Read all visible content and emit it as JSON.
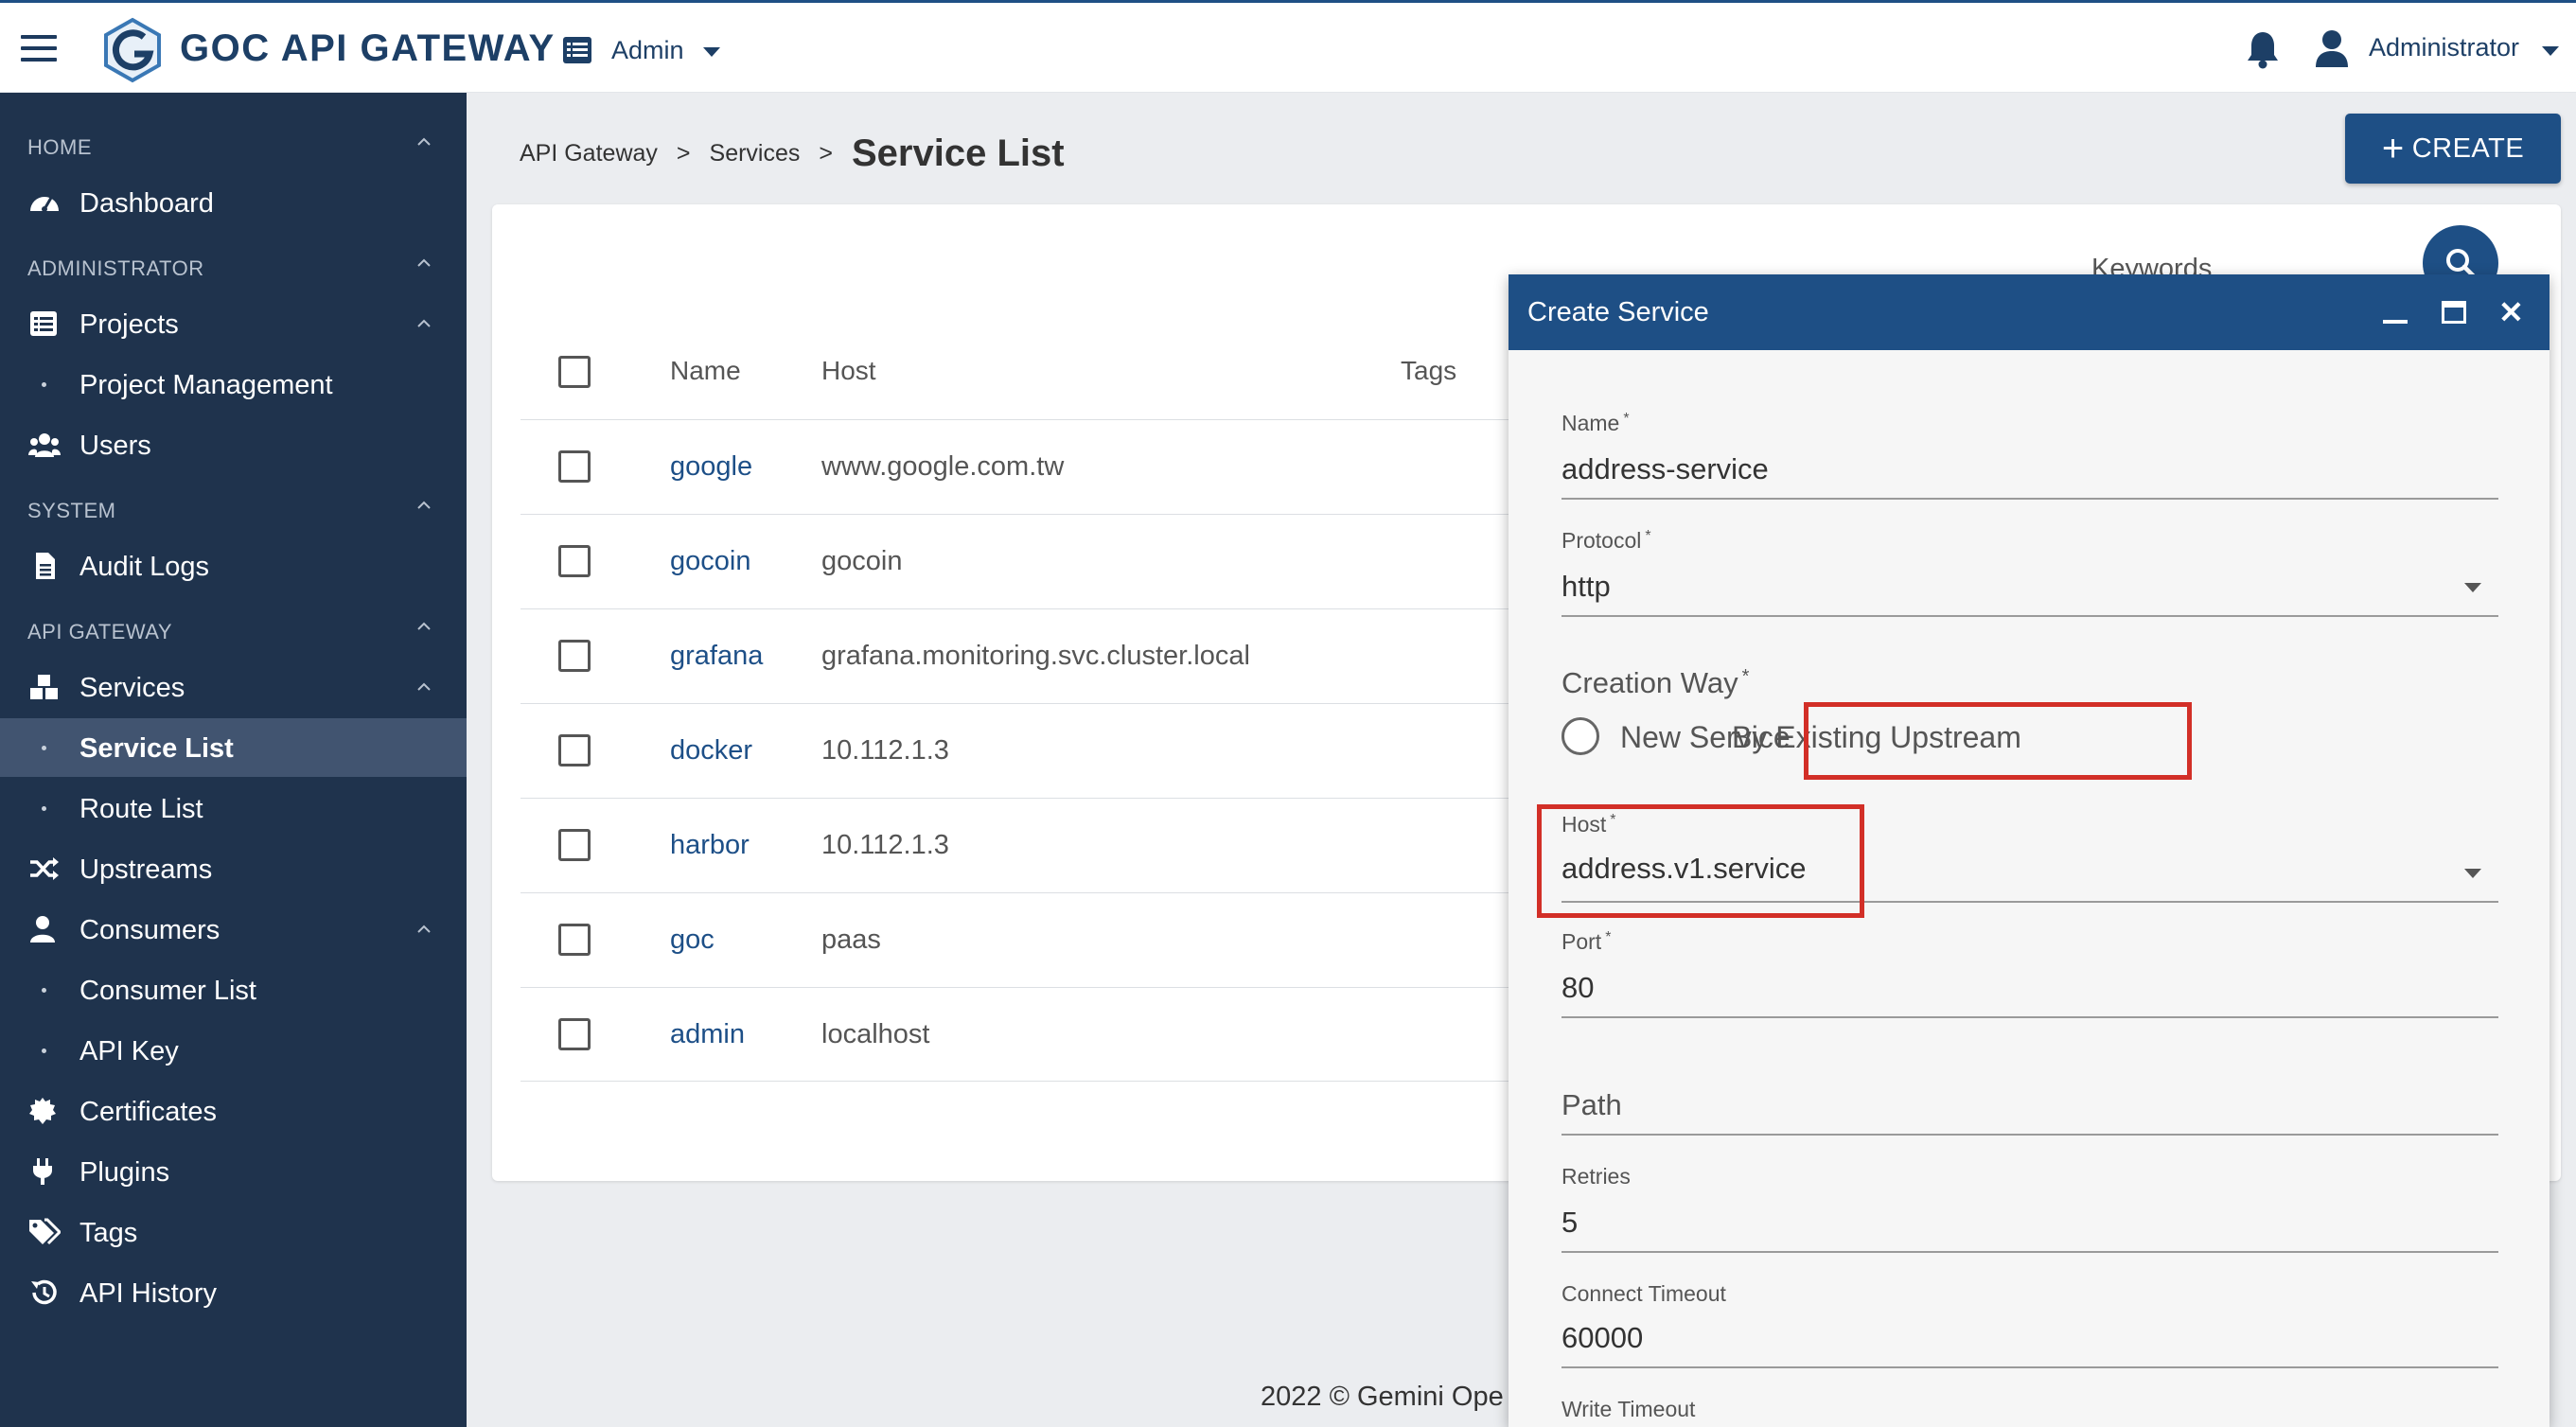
{
  "header": {
    "app_title": "GOC API GATEWAY",
    "workspace_label": "Admin",
    "user_name": "Administrator"
  },
  "sidebar": {
    "sections": [
      {
        "label": "HOME"
      },
      {
        "label": "ADMINISTRATOR"
      },
      {
        "label": "SYSTEM"
      },
      {
        "label": "API GATEWAY"
      }
    ],
    "items": [
      {
        "label": "Dashboard",
        "icon": "dashboard-icon"
      },
      {
        "label": "Projects",
        "icon": "list-icon"
      },
      {
        "label": "Project Management",
        "icon": "dot"
      },
      {
        "label": "Users",
        "icon": "users-icon"
      },
      {
        "label": "Audit Logs",
        "icon": "document-icon"
      },
      {
        "label": "Services",
        "icon": "cubes-icon"
      },
      {
        "label": "Service List",
        "icon": "dot",
        "active": true
      },
      {
        "label": "Route List",
        "icon": "dot"
      },
      {
        "label": "Upstreams",
        "icon": "shuffle-icon"
      },
      {
        "label": "Consumers",
        "icon": "user-icon"
      },
      {
        "label": "Consumer List",
        "icon": "dot"
      },
      {
        "label": "API Key",
        "icon": "dot"
      },
      {
        "label": "Certificates",
        "icon": "certificate-icon"
      },
      {
        "label": "Plugins",
        "icon": "plug-icon"
      },
      {
        "label": "Tags",
        "icon": "tags-icon"
      },
      {
        "label": "API History",
        "icon": "history-icon"
      }
    ]
  },
  "breadcrumb": {
    "items": [
      "API Gateway",
      "Services"
    ],
    "separator": ">",
    "current": "Service List"
  },
  "toolbar": {
    "create_label": "CREATE",
    "keywords_label": "Keywords"
  },
  "table": {
    "columns": [
      "Name",
      "Host",
      "Tags"
    ],
    "rows": [
      {
        "name": "google",
        "host": "www.google.com.tw"
      },
      {
        "name": "gocoin",
        "host": "gocoin"
      },
      {
        "name": "grafana",
        "host": "grafana.monitoring.svc.cluster.local"
      },
      {
        "name": "docker",
        "host": "10.112.1.3"
      },
      {
        "name": "harbor",
        "host": "10.112.1.3"
      },
      {
        "name": "goc",
        "host": "paas"
      },
      {
        "name": "admin",
        "host": "localhost"
      }
    ]
  },
  "footer": {
    "text": "2022 © Gemini Ope"
  },
  "dialog": {
    "title": "Create Service",
    "required_mark": "*",
    "fields": {
      "name": {
        "label": "Name",
        "value": "address-service"
      },
      "protocol": {
        "label": "Protocol",
        "value": "http"
      },
      "creation_way": {
        "label": "Creation Way",
        "options": [
          "New Service",
          "By Existing Upstream"
        ],
        "selected": "By Existing Upstream"
      },
      "host": {
        "label": "Host",
        "value": "address.v1.service"
      },
      "port": {
        "label": "Port",
        "value": "80"
      },
      "path": {
        "placeholder": "Path",
        "value": ""
      },
      "retries": {
        "label": "Retries",
        "value": "5"
      },
      "connect_timeout": {
        "label": "Connect Timeout",
        "value": "60000"
      },
      "write_timeout": {
        "label": "Write Timeout"
      }
    }
  },
  "colors": {
    "primary": "#1e4f85",
    "sidebar_bg": "#1f334d",
    "sidebar_active": "#415470",
    "highlight": "#d22f27",
    "link": "#1d4f87"
  }
}
